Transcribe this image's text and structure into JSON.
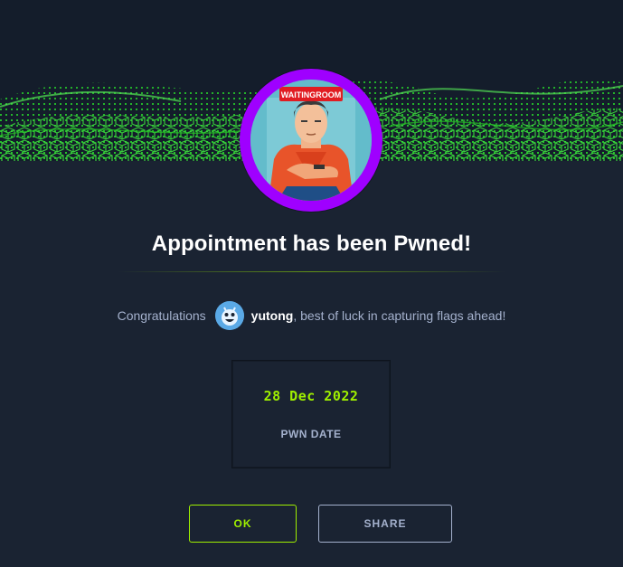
{
  "badge": {
    "sign_text": "WAITINGROOM",
    "ring_color": "#9f00ff"
  },
  "title": "Appointment has been Pwned!",
  "congrats": {
    "prefix": "Congratulations",
    "username": "yutong",
    "suffix": ", best of luck in capturing flags ahead!"
  },
  "pwn": {
    "date": "28 Dec 2022",
    "label": "PWN DATE"
  },
  "buttons": {
    "ok": "OK",
    "share": "SHARE"
  },
  "colors": {
    "background": "#1a2332",
    "accent_green": "#9fef00",
    "muted_text": "#a4b1cd"
  },
  "icons": {
    "banner": "green-wave-grid",
    "avatar": "user-avatar-icon"
  }
}
